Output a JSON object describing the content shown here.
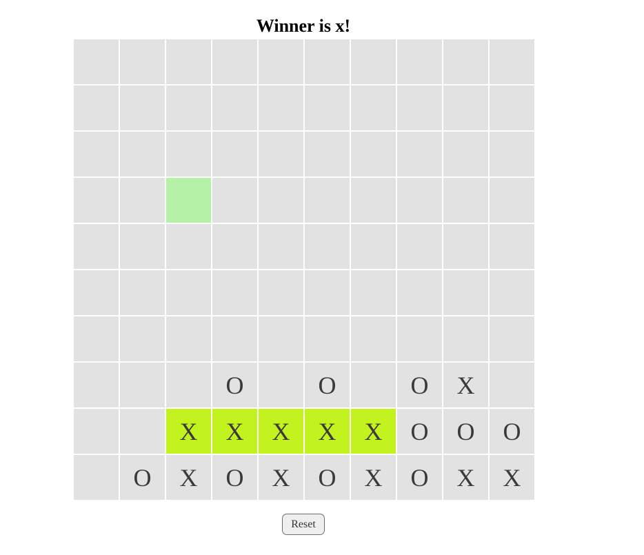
{
  "status": {
    "text": "Winner is x!"
  },
  "board": {
    "size": 10,
    "rows": [
      [
        "",
        "",
        "",
        "",
        "",
        "",
        "",
        "",
        "",
        ""
      ],
      [
        "",
        "",
        "",
        "",
        "",
        "",
        "",
        "",
        "",
        ""
      ],
      [
        "",
        "",
        "",
        "",
        "",
        "",
        "",
        "",
        "",
        ""
      ],
      [
        "",
        "",
        "",
        "",
        "",
        "",
        "",
        "",
        "",
        ""
      ],
      [
        "",
        "",
        "",
        "",
        "",
        "",
        "",
        "",
        "",
        ""
      ],
      [
        "",
        "",
        "",
        "",
        "",
        "",
        "",
        "",
        "",
        ""
      ],
      [
        "",
        "",
        "",
        "",
        "",
        "",
        "",
        "",
        "",
        ""
      ],
      [
        "",
        "",
        "",
        "O",
        "",
        "O",
        "",
        "O",
        "X",
        ""
      ],
      [
        "",
        "",
        "X",
        "X",
        "X",
        "X",
        "X",
        "O",
        "O",
        "O"
      ],
      [
        "",
        "O",
        "X",
        "O",
        "X",
        "O",
        "X",
        "O",
        "X",
        "X"
      ]
    ],
    "winning_cells": [
      [
        8,
        2
      ],
      [
        8,
        3
      ],
      [
        8,
        4
      ],
      [
        8,
        5
      ],
      [
        8,
        6
      ]
    ],
    "hovered_cell": [
      3,
      2
    ],
    "colors": {
      "cell": "#e2e2e2",
      "winning": "#c3f31f",
      "hover": "#b5f2a8"
    }
  },
  "controls": {
    "reset_label": "Reset"
  }
}
